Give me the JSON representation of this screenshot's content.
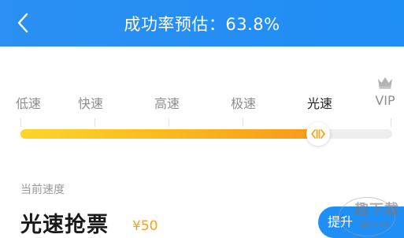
{
  "header": {
    "title": "成功率预估：63.8%",
    "back_icon": "chevron-left-icon"
  },
  "speed_levels": [
    {
      "label": "低速"
    },
    {
      "label": "快速"
    },
    {
      "label": "高速"
    },
    {
      "label": "极速"
    },
    {
      "label": "光速"
    },
    {
      "label": "VIP"
    }
  ],
  "slider": {
    "selected_label": "光速",
    "value_fraction": 0.8,
    "track_color": "#eeeeee",
    "fill_colors": [
      "#fcd52a",
      "#f7991b"
    ],
    "handle_icon": "drag-handle-icon"
  },
  "vip_icon": "crown-icon",
  "current": {
    "label": "当前速度",
    "name": "光速抢票",
    "price": "¥50"
  },
  "upgrade_button": {
    "label": "提升"
  },
  "watermark": {
    "top_text": "趣下载",
    "bottom_text": "q2d.com"
  },
  "colors": {
    "header_blue": "#1f8ef5",
    "accent_orange": "#f6a21a",
    "muted_text": "#8e8e8e"
  }
}
